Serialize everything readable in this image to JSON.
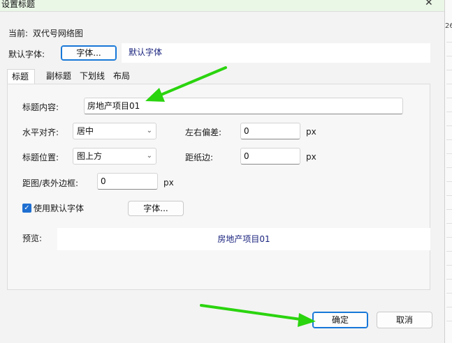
{
  "window": {
    "title": "设置标题",
    "close_glyph": "✕"
  },
  "current": {
    "prefix": "当前:",
    "name": "双代号网络图"
  },
  "default_font": {
    "label": "默认字体:",
    "button_label": "字体...",
    "preview_text": "默认字体"
  },
  "tabs": [
    {
      "label": "标题",
      "active": true
    },
    {
      "label": "副标题",
      "active": false
    },
    {
      "label": "下划线",
      "active": false
    },
    {
      "label": "布局",
      "active": false
    }
  ],
  "title_tab": {
    "content_label": "标题内容:",
    "content_value": "房地产项目01",
    "halign_label": "水平对齐:",
    "halign_value": "居中",
    "offset_lr_label": "左右偏差:",
    "offset_lr_value": "0",
    "offset_lr_unit": "px",
    "position_label": "标题位置:",
    "position_value": "图上方",
    "paper_dist_label": "距纸边:",
    "paper_dist_value": "0",
    "paper_dist_unit": "px",
    "border_dist_label": "距图/表外边框:",
    "border_dist_value": "0",
    "border_dist_unit": "px",
    "use_default_font_label": "使用默认字体",
    "use_default_font_checked": true,
    "font_button_label": "字体...",
    "preview_label": "预览:",
    "preview_text": "房地产项目01"
  },
  "footer": {
    "ok_label": "确定",
    "cancel_label": "取消"
  },
  "side_stub": "26",
  "colors": {
    "accent": "#1677d8",
    "arrow": "#2ad40e",
    "titlebar": "#eaf6e6",
    "preview_text": "#1a237e"
  }
}
